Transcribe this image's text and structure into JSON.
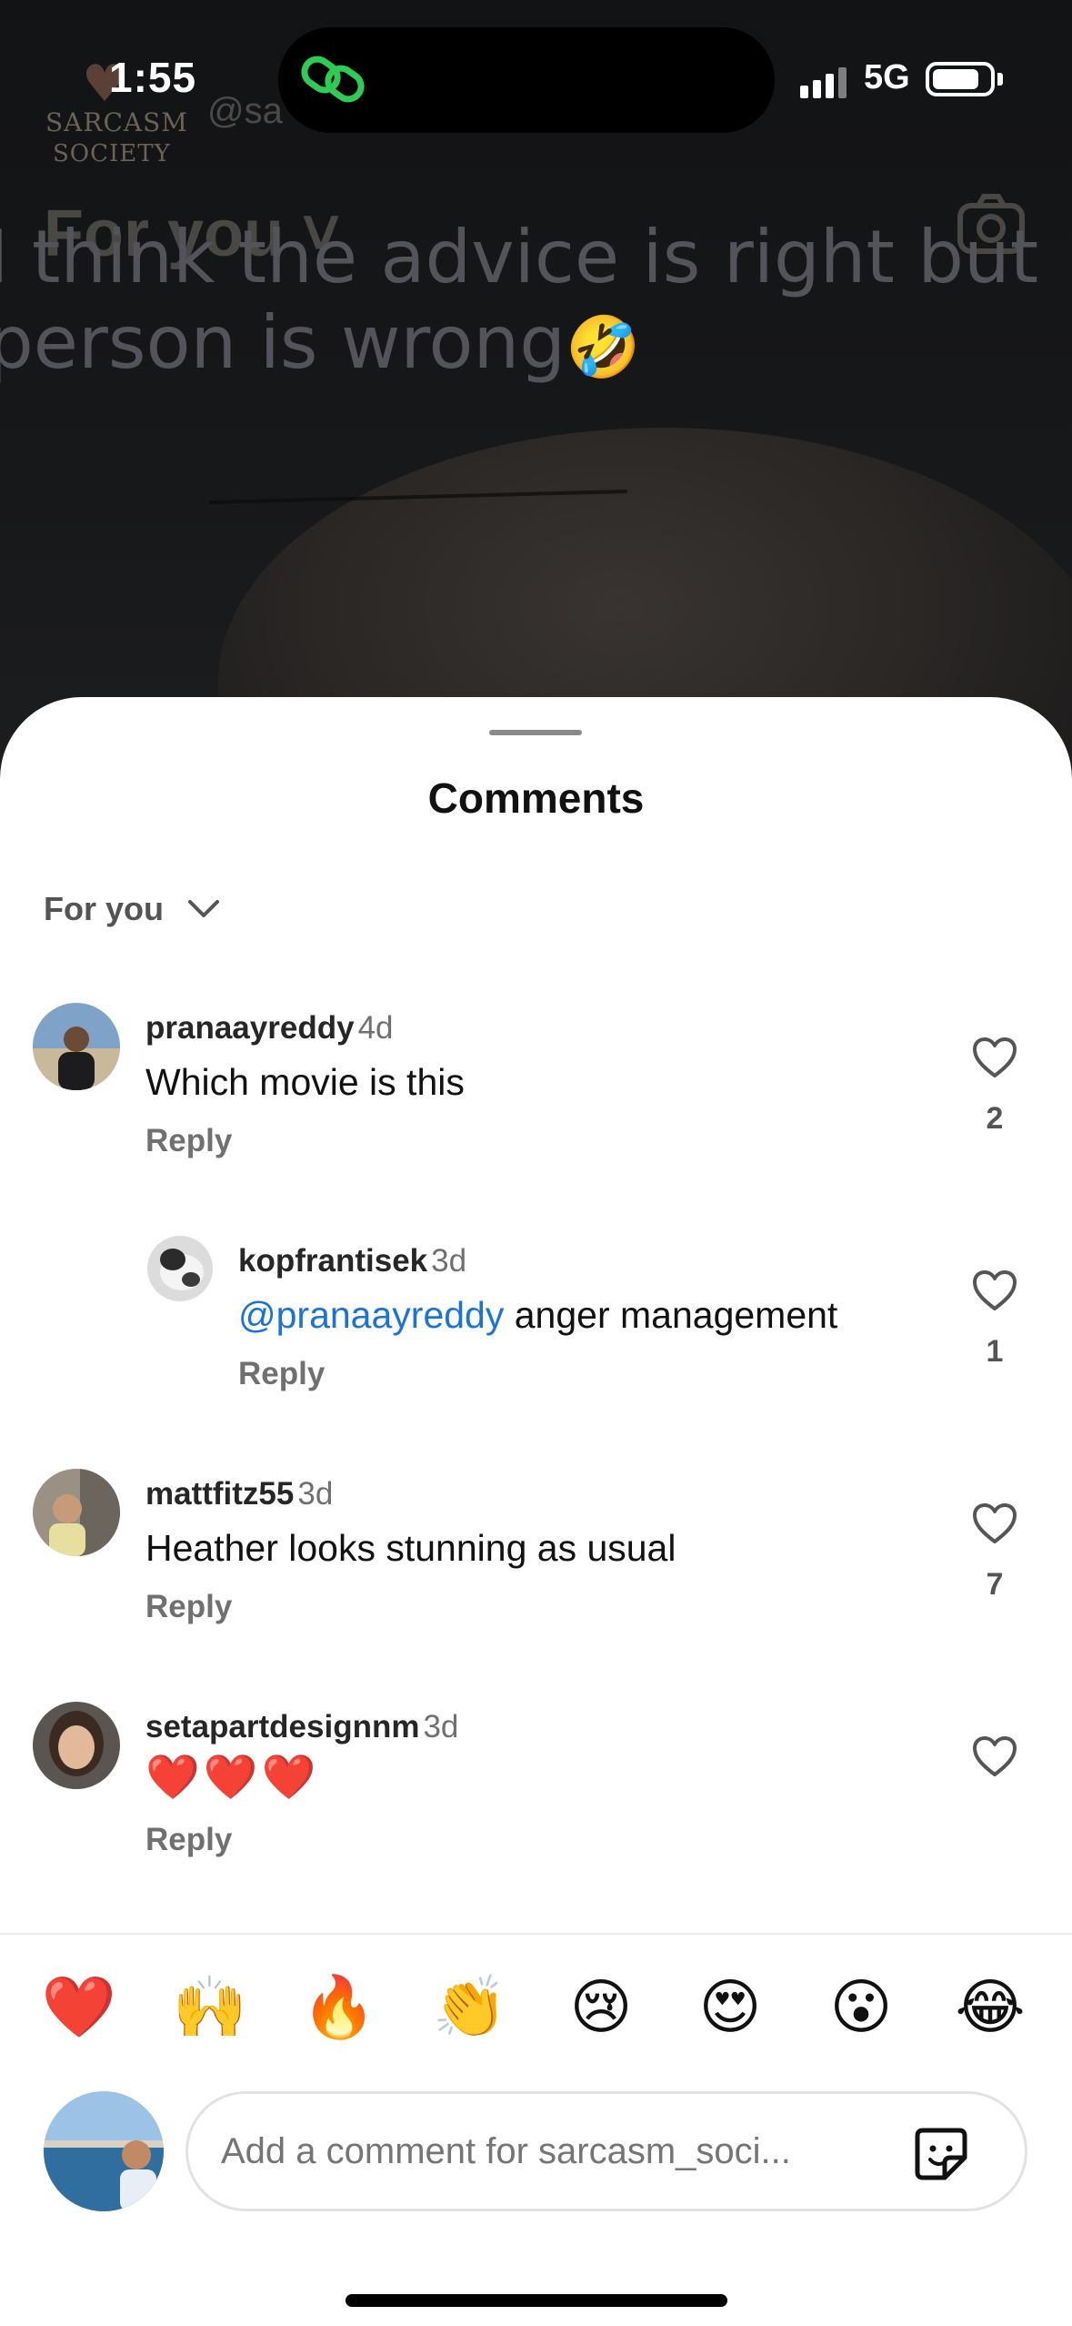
{
  "status_bar": {
    "time": "1:55",
    "network": "5G",
    "battery_level": 0.84
  },
  "reel": {
    "brand_top": "SARCASM",
    "brand_bottom": "SOCIETY",
    "handle_partial": "@sa",
    "feed_label": "For you",
    "caption": "I think the advice is right but",
    "caption_line2": "person is wrong",
    "caption_emoji": "🤣"
  },
  "sheet": {
    "title": "Comments",
    "filter_label": "For you"
  },
  "comments": [
    {
      "username": "pranaayreddy",
      "age": "4d",
      "text": "Which movie is this",
      "mention": "",
      "reply_label": "Reply",
      "likes": "2"
    },
    {
      "username": "kopfrantisek",
      "age": "3d",
      "mention": "@pranaayreddy",
      "text": " anger management",
      "reply_label": "Reply",
      "likes": "1"
    },
    {
      "username": "mattfitz55",
      "age": "3d",
      "text": "Heather looks stunning as usual",
      "mention": "",
      "reply_label": "Reply",
      "likes": "7"
    },
    {
      "username": "setapartdesignnm",
      "age": "3d",
      "text": "❤️❤️❤️",
      "mention": "",
      "reply_label": "Reply",
      "likes": ""
    }
  ],
  "quick_emojis": [
    "❤️",
    "🙌",
    "🔥",
    "👏",
    "😢",
    "😍",
    "😮",
    "😂"
  ],
  "compose": {
    "placeholder": "Add a comment for sarcasm_soci..."
  },
  "icons": {
    "island": "link-icon",
    "camera": "camera-icon",
    "filter": "chevron-down-icon",
    "like": "heart-outline-icon",
    "sticker": "sticker-icon"
  },
  "colors": {
    "mention": "#1a73d6",
    "island_icon": "#2ecc55"
  }
}
